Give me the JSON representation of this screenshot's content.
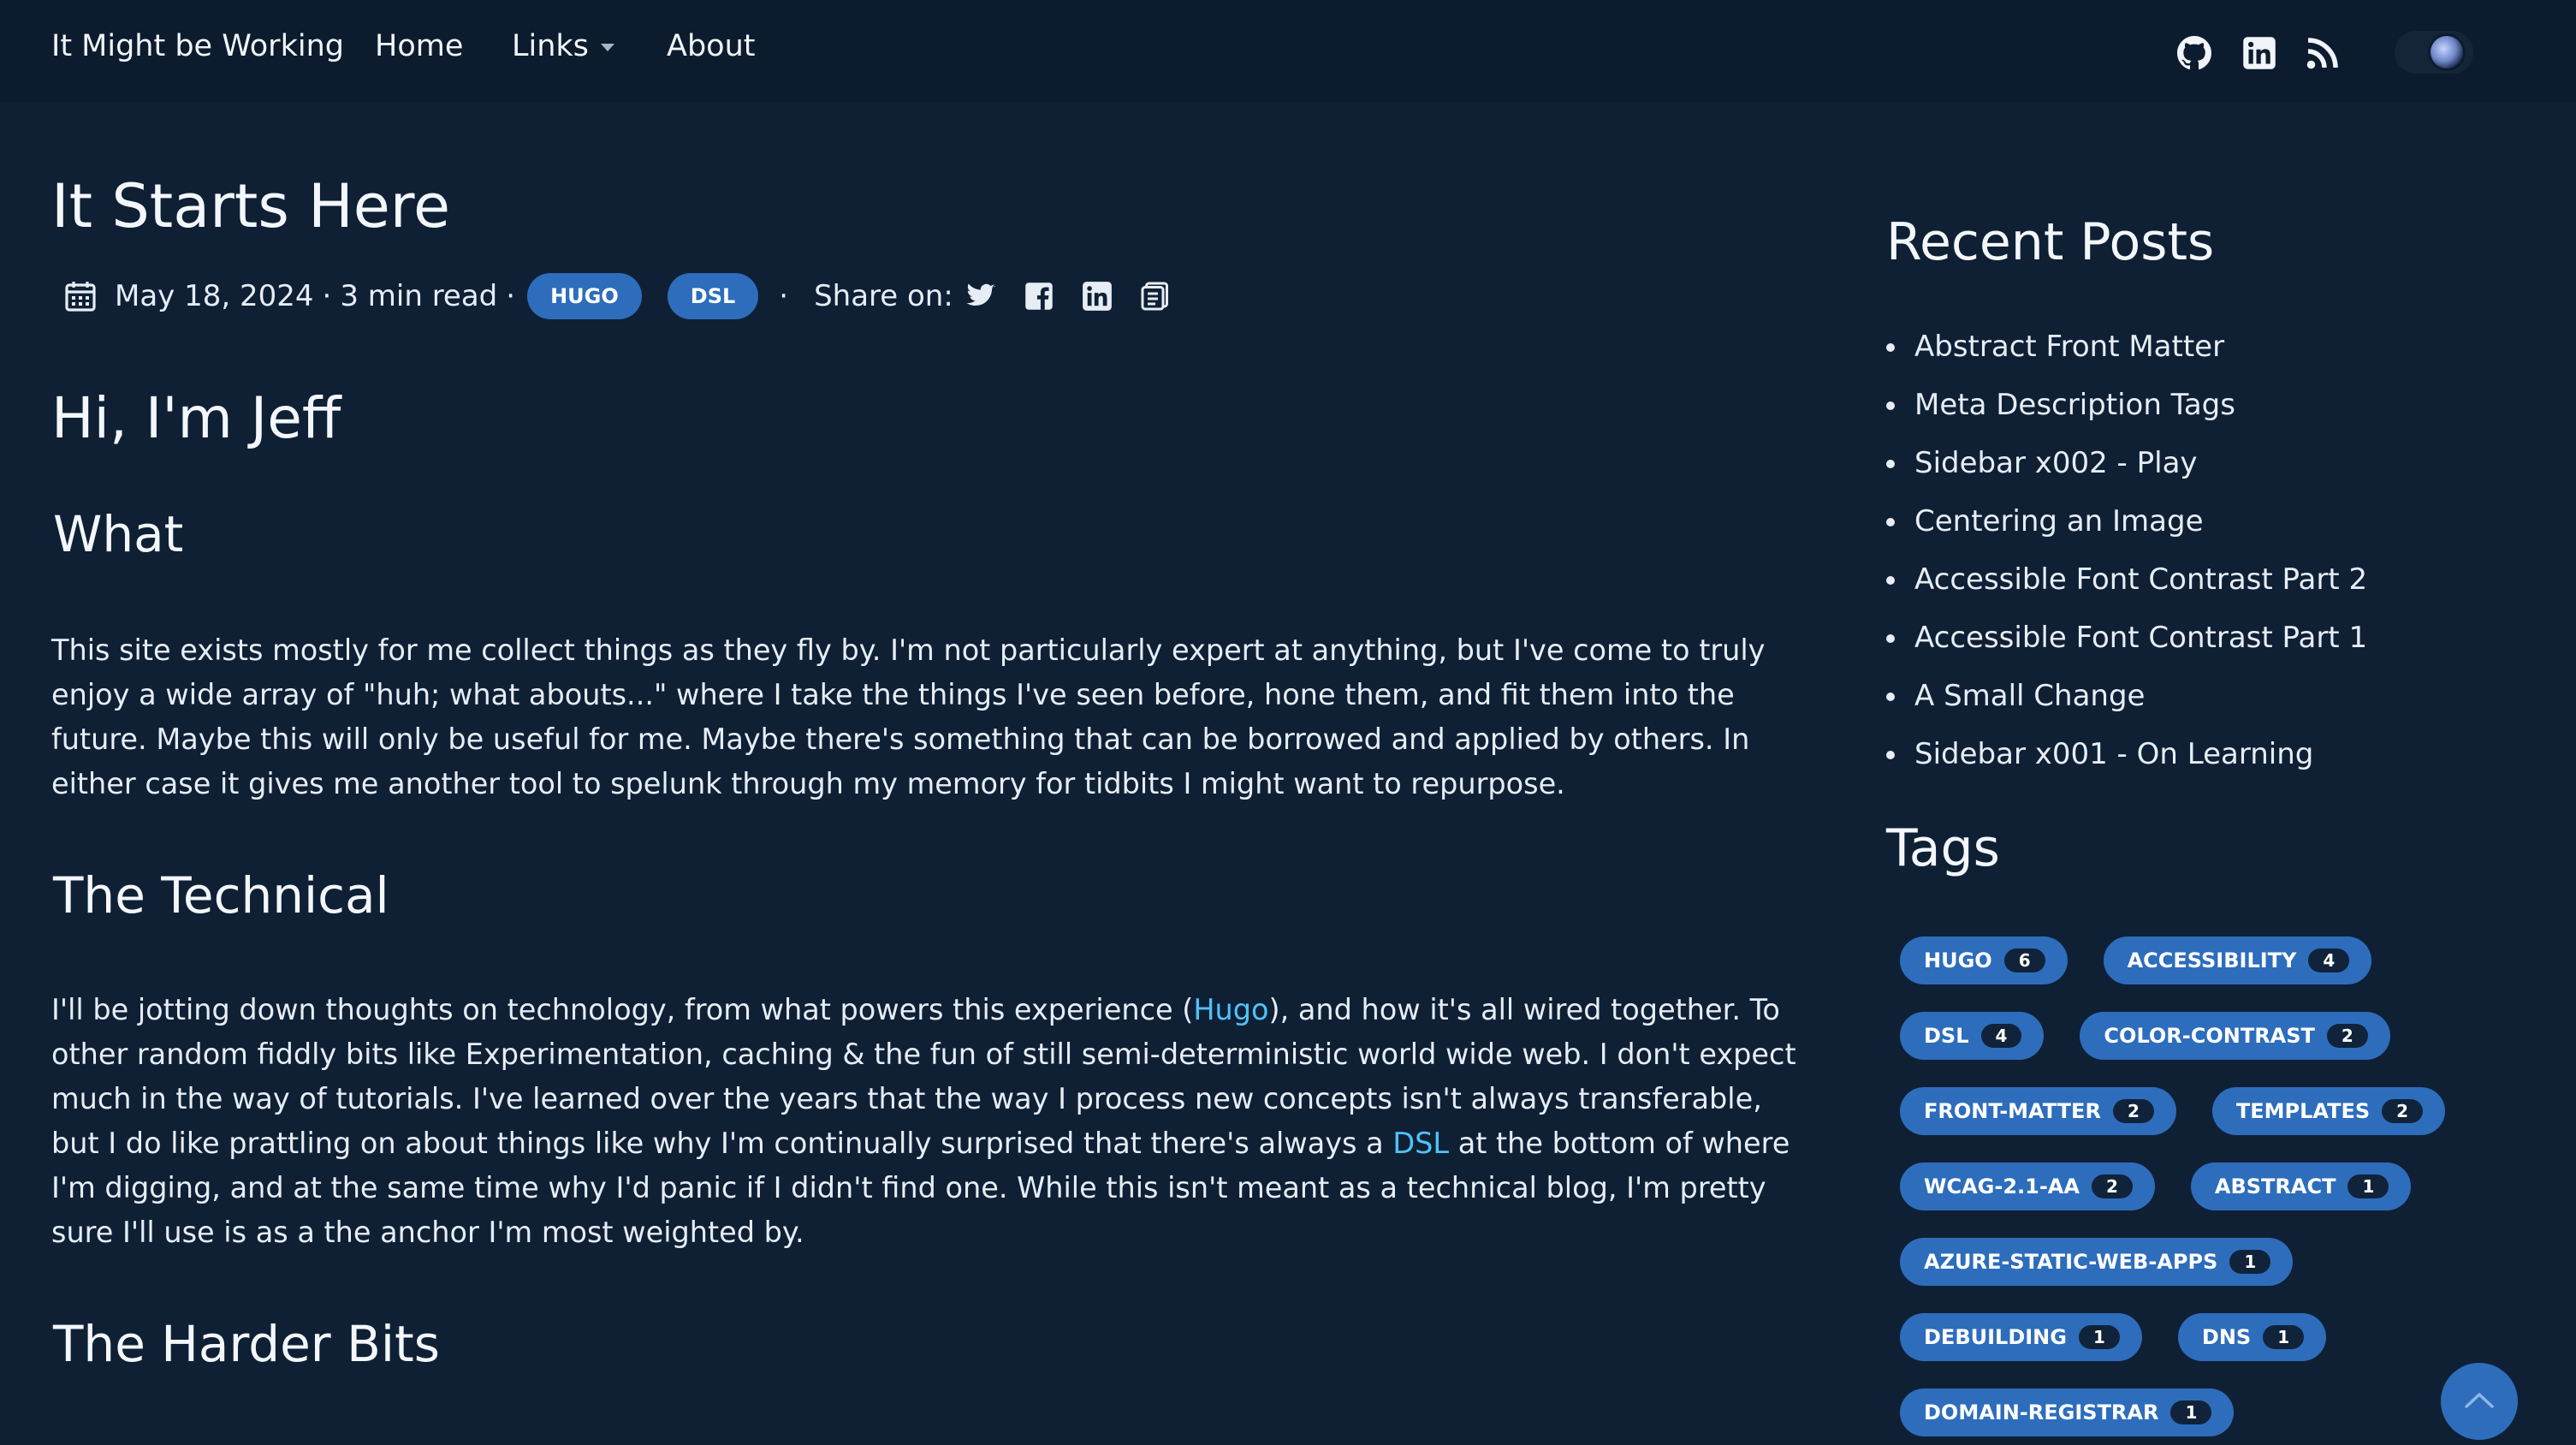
{
  "nav": {
    "brand": "It Might be Working",
    "home": "Home",
    "links": "Links",
    "about": "About",
    "icons": [
      "github-icon",
      "linkedin-icon",
      "rss-icon"
    ],
    "theme_toggle": "dark"
  },
  "post": {
    "title": "It Starts Here",
    "date": "May 18, 2024",
    "read_time": "3 min read",
    "tags": [
      "HUGO",
      "DSL"
    ],
    "share_label": "Share on:",
    "share_icons": [
      "twitter-icon",
      "facebook-icon",
      "linkedin-icon",
      "copy-icon"
    ]
  },
  "content": {
    "heading": "Hi, I'm Jeff",
    "what_heading": "What",
    "what_text": "This site exists mostly for me collect things as they fly by. I'm not particularly expert at anything, but I've come to truly enjoy a wide array of \"huh; what abouts...\" where I take the things I've seen before, hone them, and fit them into the future. Maybe this will only be useful for me. Maybe there's something that can be borrowed and applied by others. In either case it gives me another tool to spelunk through my memory for tidbits I might want to repurpose.",
    "tech_heading": "The Technical",
    "tech_text_1": "I'll be jotting down thoughts on technology, from what powers this experience (",
    "tech_link_hugo": "Hugo",
    "tech_text_2": "), and how it's all wired together. To other random fiddly bits like Experimentation, caching & the fun of still semi-deterministic world wide web. I don't expect much in the way of tutorials. I've learned over the years that the way I process new concepts isn't always transferable, but I do like prattling on about things like why I'm continually surprised that there's always a ",
    "tech_link_dsl": "DSL",
    "tech_text_3": " at the bottom of where I'm digging, and at the same time why I'd panic if I didn't find one. While this isn't meant as a technical blog, I'm pretty sure I'll use is as a the anchor I'm most weighted by.",
    "harder_heading": "The Harder Bits"
  },
  "sidebar": {
    "recent_heading": "Recent Posts",
    "recent_posts": [
      "Abstract Front Matter",
      "Meta Description Tags",
      "Sidebar x002 - Play",
      "Centering an Image",
      "Accessible Font Contrast Part 2",
      "Accessible Font Contrast Part 1",
      "A Small Change",
      "Sidebar x001 - On Learning"
    ],
    "tags_heading": "Tags",
    "tags": [
      {
        "name": "HUGO",
        "count": "6"
      },
      {
        "name": "ACCESSIBILITY",
        "count": "4"
      },
      {
        "name": "DSL",
        "count": "4"
      },
      {
        "name": "COLOR-CONTRAST",
        "count": "2"
      },
      {
        "name": "FRONT-MATTER",
        "count": "2"
      },
      {
        "name": "TEMPLATES",
        "count": "2"
      },
      {
        "name": "WCAG-2.1-AA",
        "count": "2"
      },
      {
        "name": "ABSTRACT",
        "count": "1"
      },
      {
        "name": "AZURE-STATIC-WEB-APPS",
        "count": "1"
      },
      {
        "name": "DEBUILDING",
        "count": "1"
      },
      {
        "name": "DNS",
        "count": "1"
      },
      {
        "name": "DOMAIN-REGISTRAR",
        "count": "1"
      }
    ]
  },
  "colors": {
    "background": "#0f2035",
    "navbar": "#0c1c2e",
    "accent": "#2d6dbc",
    "link": "#4fc3f7",
    "text": "#e6edf5"
  }
}
